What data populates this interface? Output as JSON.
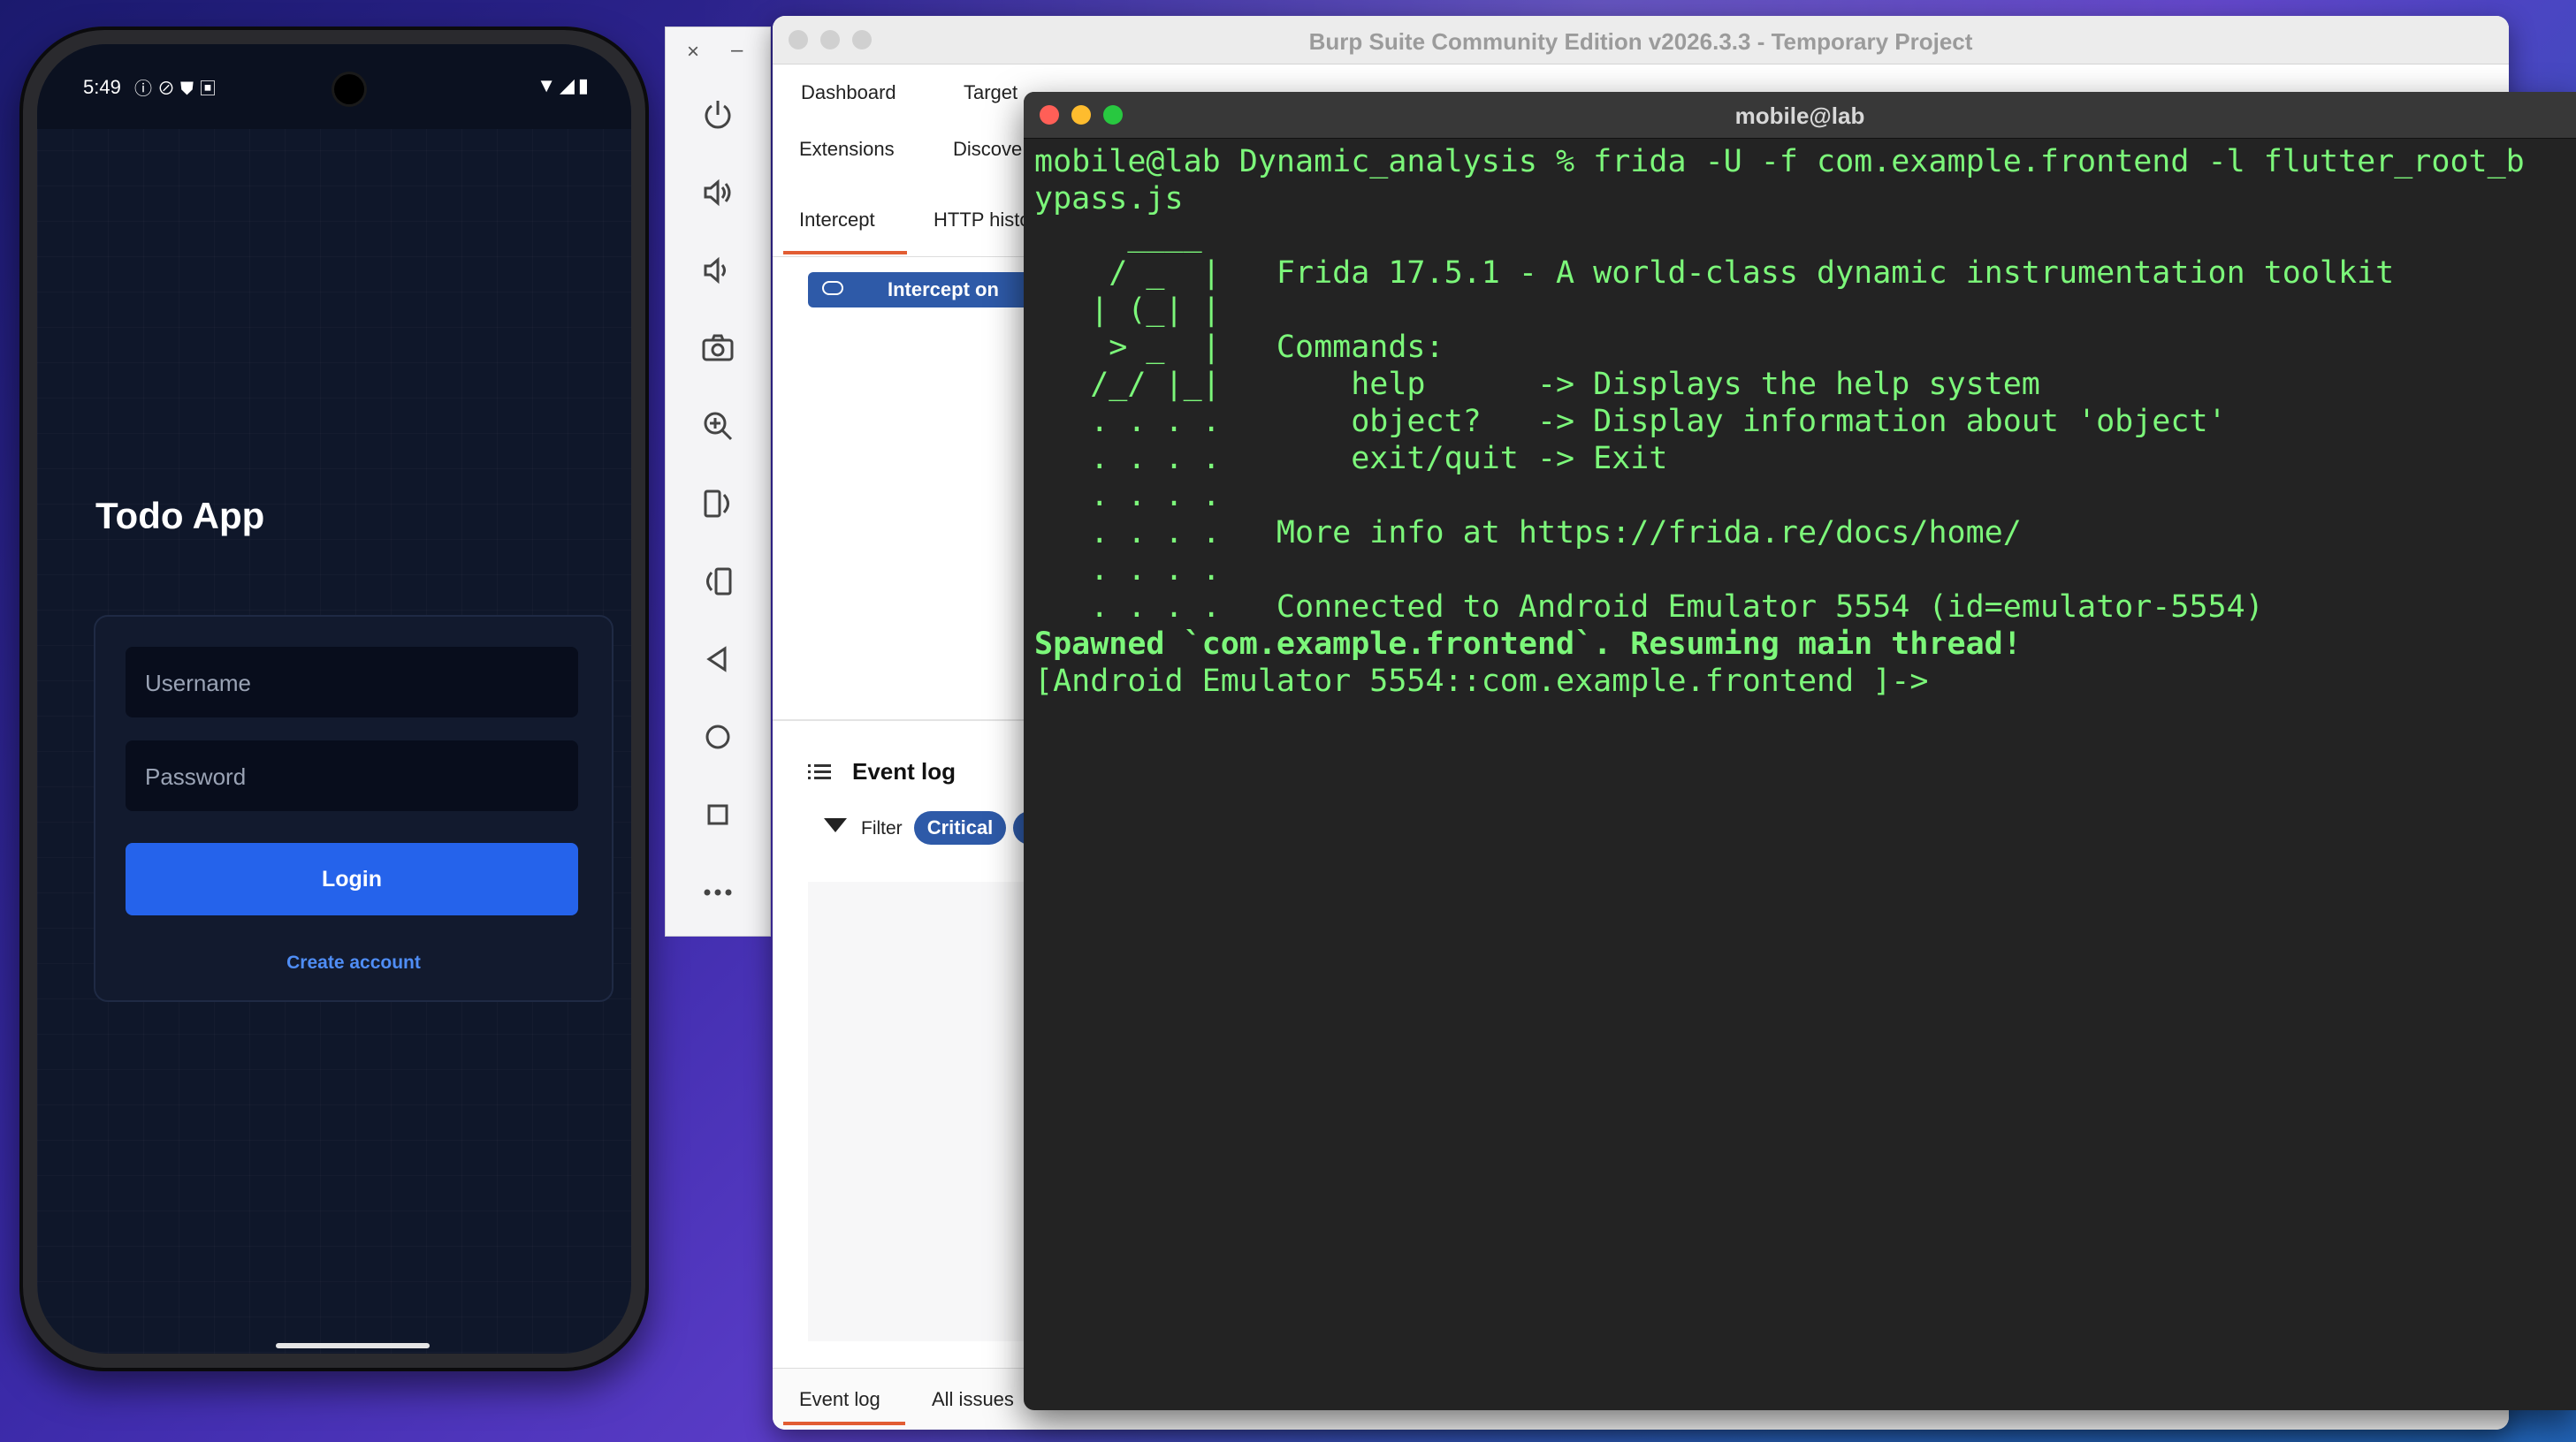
{
  "phone": {
    "status_time": "5:49",
    "status_left_icons": "ⓘ⊘⛊▣",
    "status_right_icons": "▼◢▮",
    "app_title": "Todo App",
    "username_placeholder": "Username",
    "password_placeholder": "Password",
    "login_label": "Login",
    "create_account_label": "Create account",
    "colors": {
      "background": "#0f172a",
      "primary_button": "#2563eb",
      "link": "#4f8df5"
    }
  },
  "emulator_toolbar": {
    "close_glyph": "×",
    "minimize_glyph": "–",
    "icons": [
      "power-icon",
      "volume-up-icon",
      "volume-down-icon",
      "camera-icon",
      "zoom-in-icon",
      "rotate-left-icon",
      "rotate-right-icon",
      "back-icon",
      "home-icon",
      "overview-icon",
      "more-icon"
    ]
  },
  "burp": {
    "window_title": "Burp Suite Community Edition v2026.3.3 - Temporary Project",
    "nav_row1": [
      "Dashboard",
      "Target"
    ],
    "nav_row2": [
      "Extensions",
      "Discove"
    ],
    "subtabs": [
      "Intercept",
      "HTTP histo"
    ],
    "intercept_button": "Intercept on",
    "event_log_title": "Event log",
    "filter_label": "Filter",
    "filter_badge": "Critical",
    "bottom_tabs": [
      "Event log",
      "All issues"
    ],
    "colors": {
      "accent": "#e25d33",
      "button": "#2e5aa8"
    }
  },
  "terminal": {
    "title": "mobile@lab",
    "lines": [
      {
        "text": "mobile@lab Dynamic_analysis % frida -U -f com.example.frontend -l flutter_root_b",
        "bold": false
      },
      {
        "text": "ypass.js",
        "bold": false
      },
      {
        "text": "     ____",
        "bold": false
      },
      {
        "text": "    / _  |   Frida 17.5.1 - A world-class dynamic instrumentation toolkit",
        "bold": false
      },
      {
        "text": "   | (_| |",
        "bold": false
      },
      {
        "text": "    > _  |   Commands:",
        "bold": false
      },
      {
        "text": "   /_/ |_|       help      -> Displays the help system",
        "bold": false
      },
      {
        "text": "   . . . .       object?   -> Display information about 'object'",
        "bold": false
      },
      {
        "text": "   . . . .       exit/quit -> Exit",
        "bold": false
      },
      {
        "text": "   . . . .",
        "bold": false
      },
      {
        "text": "   . . . .   More info at https://frida.re/docs/home/",
        "bold": false
      },
      {
        "text": "   . . . .",
        "bold": false
      },
      {
        "text": "   . . . .   Connected to Android Emulator 5554 (id=emulator-5554)",
        "bold": false
      },
      {
        "text": "Spawned `com.example.frontend`. Resuming main thread!",
        "bold": true
      },
      {
        "text": "[Android Emulator 5554::com.example.frontend ]->",
        "bold": false
      }
    ],
    "colors": {
      "text": "#7cf77a",
      "background": "#232323"
    }
  }
}
